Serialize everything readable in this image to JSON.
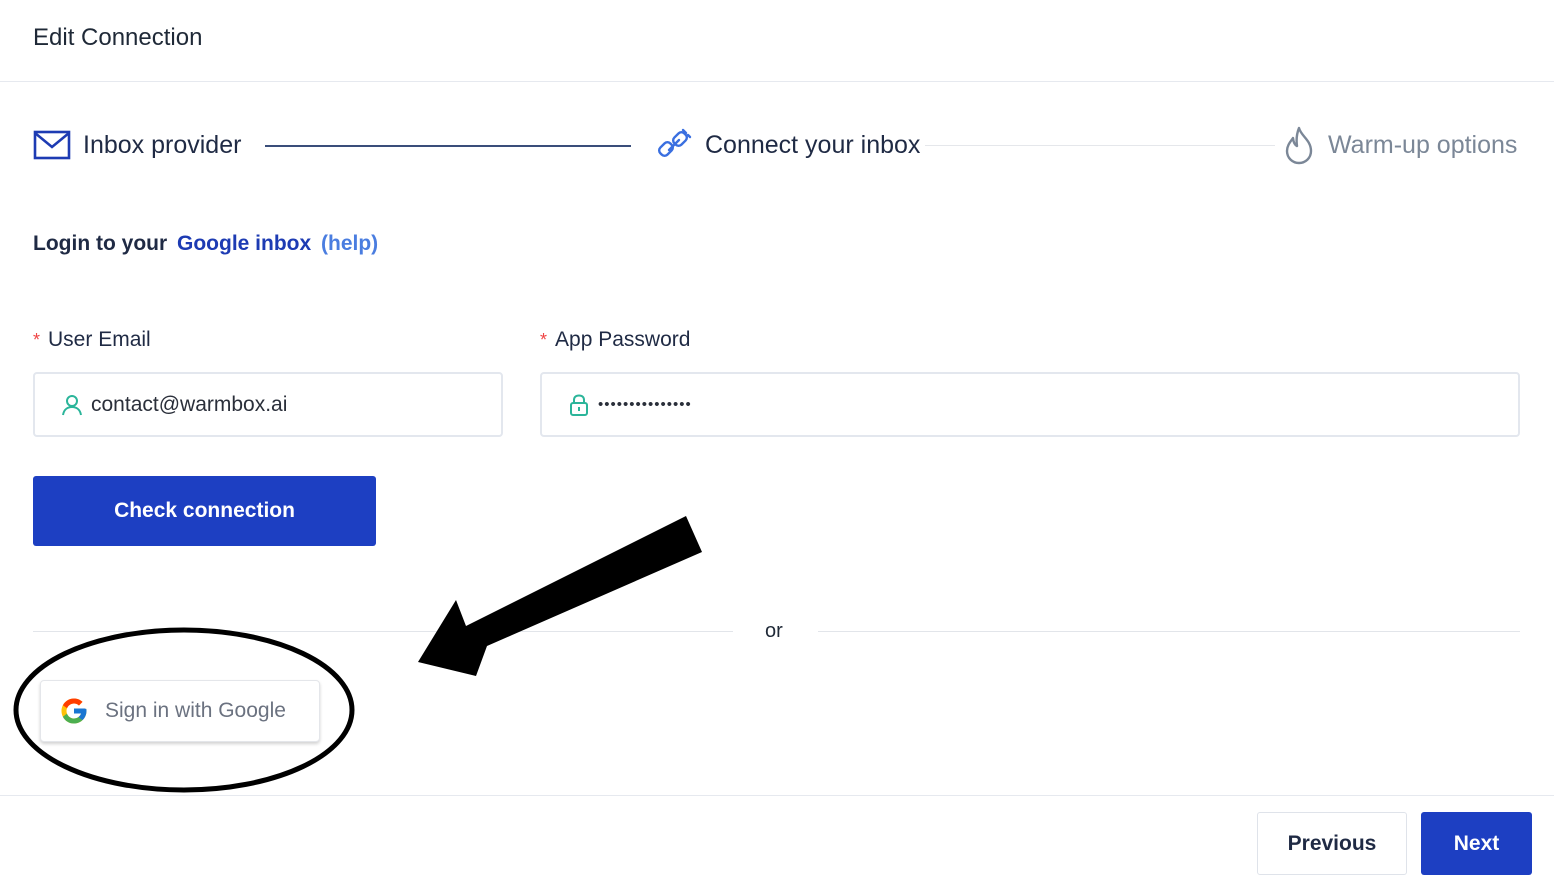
{
  "header": {
    "title": "Edit Connection"
  },
  "steps": [
    {
      "label": "Inbox provider",
      "icon": "mail-icon"
    },
    {
      "label": "Connect your inbox",
      "icon": "link-icon"
    },
    {
      "label": "Warm-up options",
      "icon": "flame-icon"
    }
  ],
  "login": {
    "prefix": "Login to your",
    "provider": "Google inbox",
    "help": "(help)"
  },
  "form": {
    "required_mark": "*",
    "email": {
      "label": "User Email",
      "value": "contact@warmbox.ai",
      "icon": "user-icon"
    },
    "password": {
      "label": "App Password",
      "value": "•••••••••••••••",
      "icon": "lock-icon"
    }
  },
  "actions": {
    "check": "Check connection",
    "or": "or",
    "google": "Sign in with Google"
  },
  "footer": {
    "previous": "Previous",
    "next": "Next"
  },
  "colors": {
    "primary": "#1d3fc2",
    "accent_icon": "#2bb59a",
    "link_light": "#4a7de0"
  }
}
